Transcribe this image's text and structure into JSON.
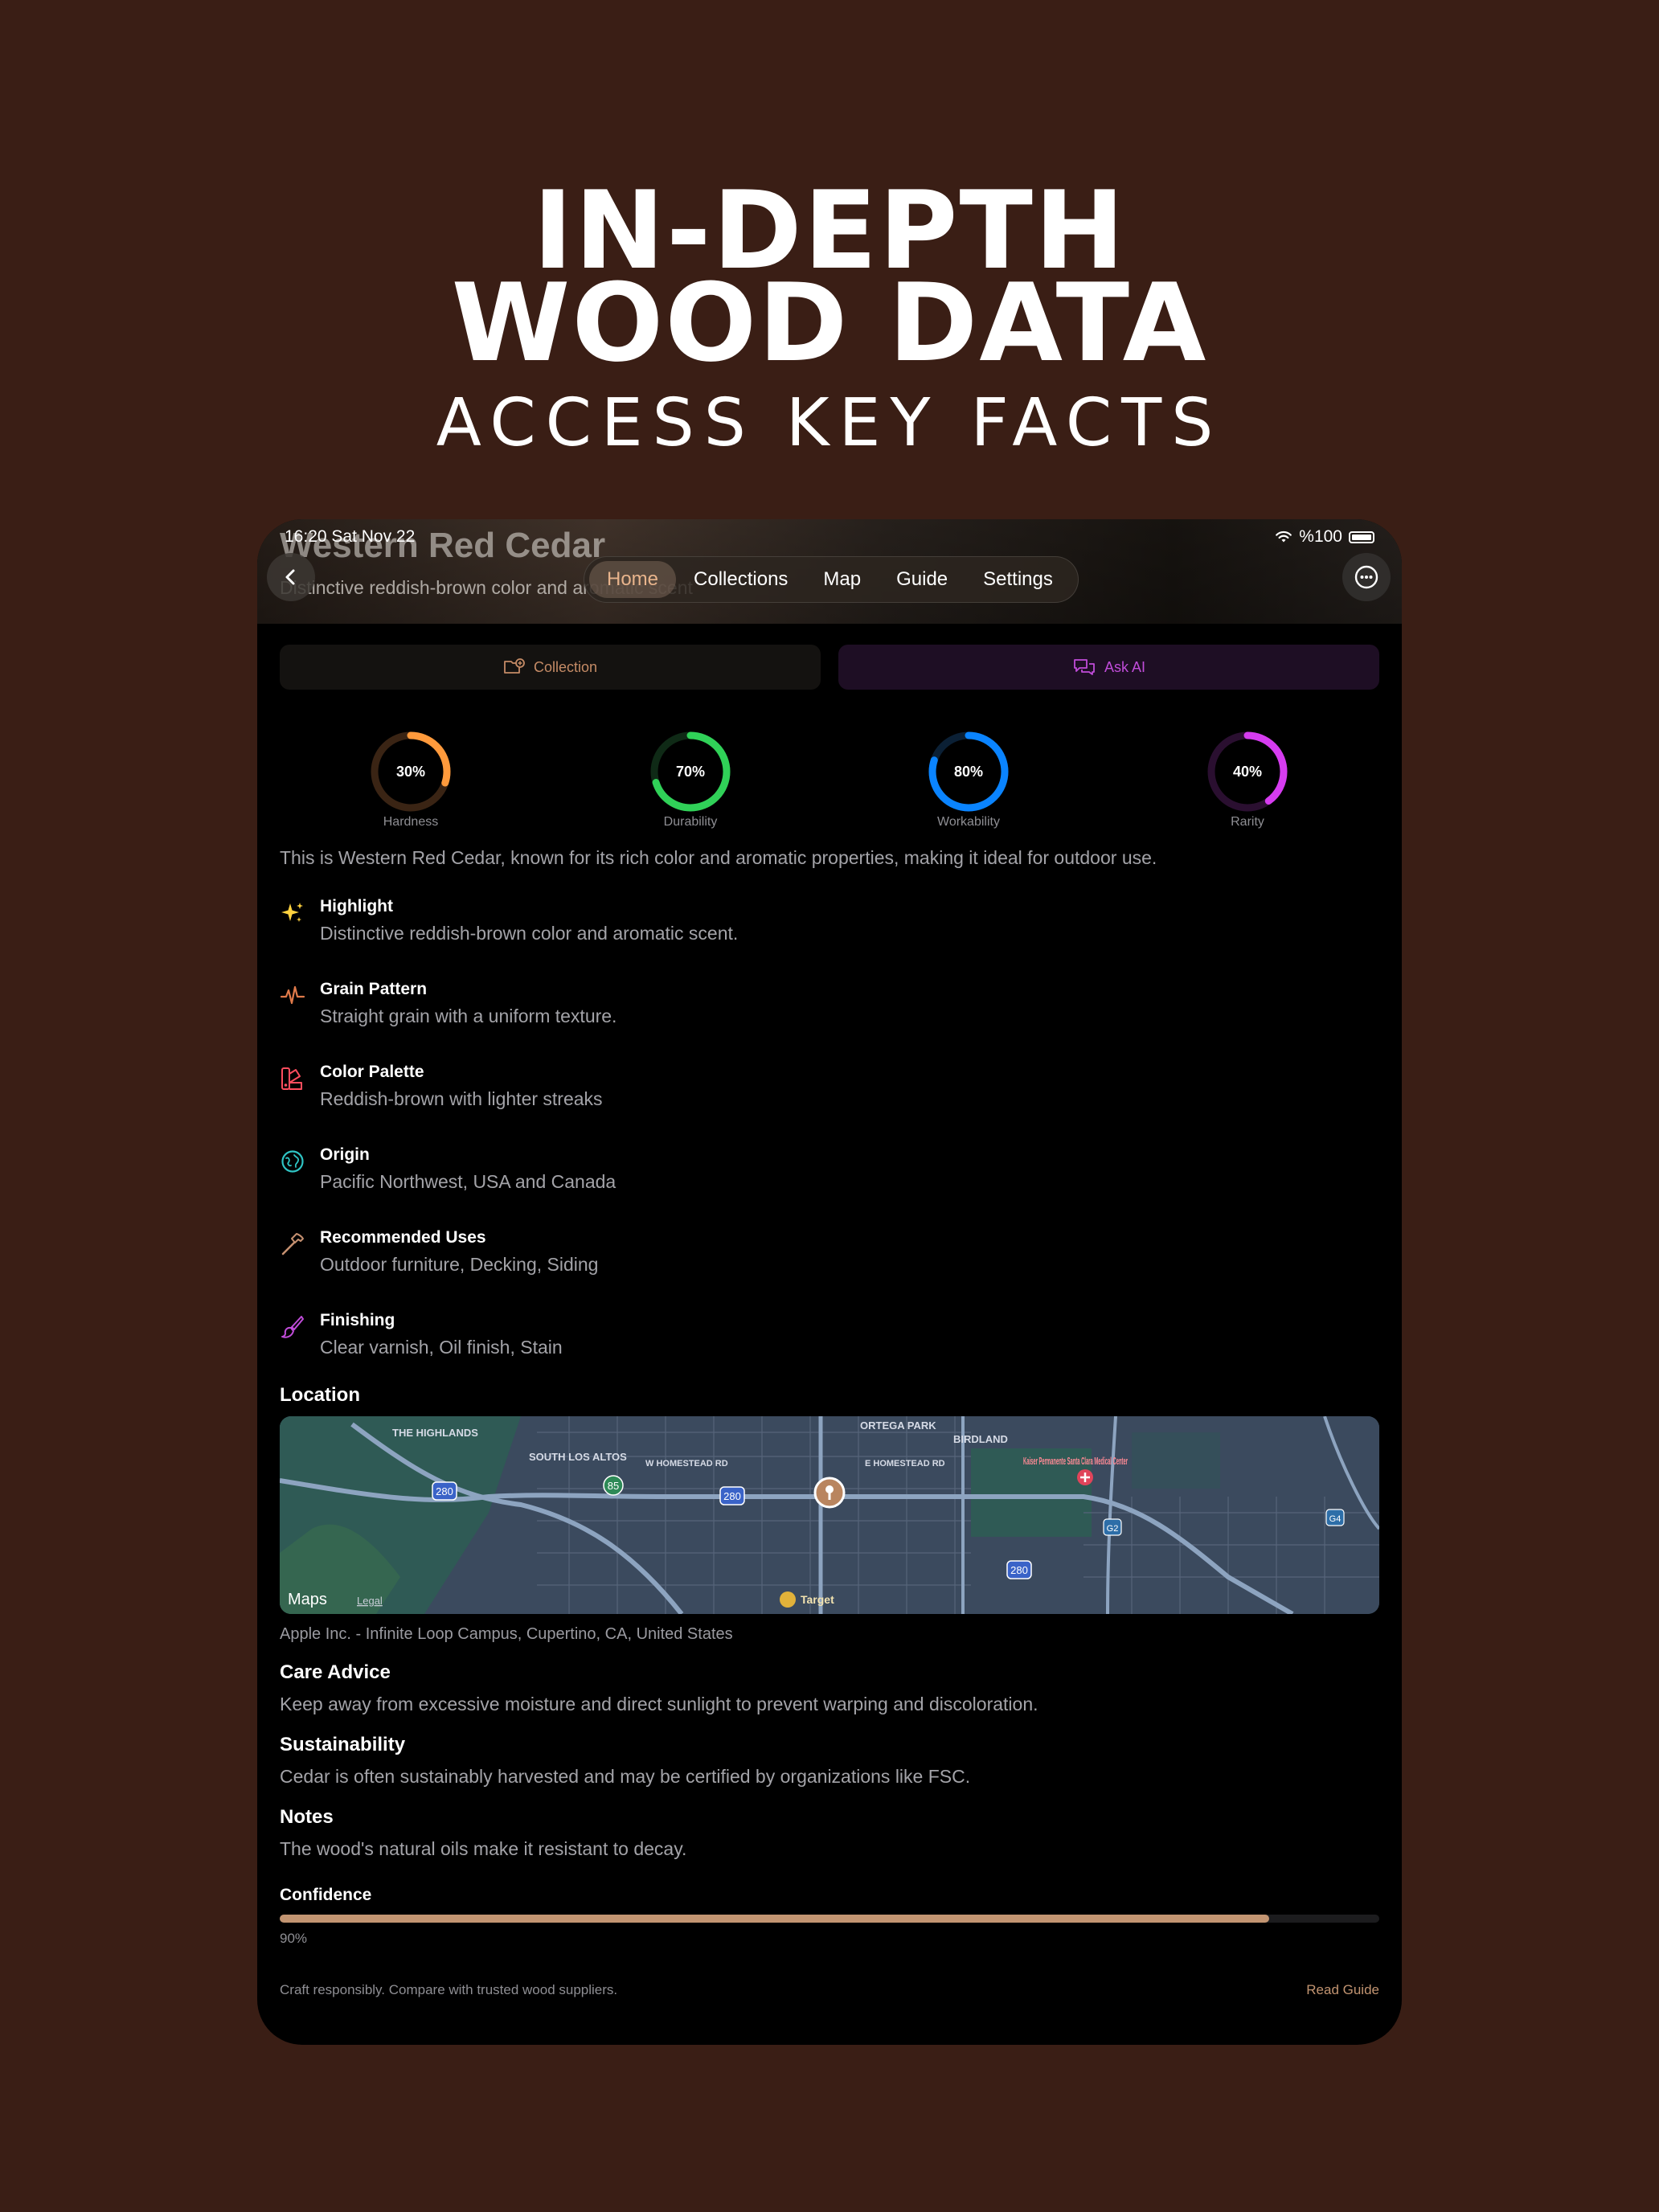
{
  "hero": {
    "line1": "IN-DEPTH",
    "line2": "WOOD DATA",
    "subtitle": "ACCESS KEY FACTS"
  },
  "status_bar": {
    "time": "16:20  Sat Nov 22",
    "battery": "%100"
  },
  "header": {
    "title": "Western Red Cedar",
    "subtitle": "Distinctive reddish-brown color and aromatic scent"
  },
  "tabs": [
    {
      "label": "Home",
      "active": true
    },
    {
      "label": "Collections",
      "active": false
    },
    {
      "label": "Map",
      "active": false
    },
    {
      "label": "Guide",
      "active": false
    },
    {
      "label": "Settings",
      "active": false
    }
  ],
  "actions": {
    "collection_label": "Collection",
    "ask_ai_label": "Ask AI"
  },
  "gauges": [
    {
      "label": "Hardness",
      "value": 30,
      "display": "30%",
      "color": "#ff9a3c",
      "track": "#3a2414"
    },
    {
      "label": "Durability",
      "value": 70,
      "display": "70%",
      "color": "#30d158",
      "track": "#0f2a16"
    },
    {
      "label": "Workability",
      "value": 80,
      "display": "80%",
      "color": "#0a84ff",
      "track": "#0b2035"
    },
    {
      "label": "Rarity",
      "value": 40,
      "display": "40%",
      "color": "#d63cf0",
      "track": "#2a0f30"
    }
  ],
  "summary": "This is Western Red Cedar, known for its rich color and aromatic properties, making it ideal for outdoor use.",
  "attributes": [
    {
      "title": "Highlight",
      "value": "Distinctive reddish-brown color and aromatic scent.",
      "icon": "sparkles-icon",
      "color": "#ffd23f"
    },
    {
      "title": "Grain Pattern",
      "value": "Straight grain with a uniform texture.",
      "icon": "waveform-icon",
      "color": "#e07a4a"
    },
    {
      "title": "Color Palette",
      "value": "Reddish-brown with lighter streaks",
      "icon": "swatch-icon",
      "color": "#ff4d5e"
    },
    {
      "title": "Origin",
      "value": "Pacific Northwest, USA and Canada",
      "icon": "globe-icon",
      "color": "#2fc4c4"
    },
    {
      "title": "Recommended Uses",
      "value": "Outdoor furniture, Decking, Siding",
      "icon": "hammer-icon",
      "color": "#c59070"
    },
    {
      "title": "Finishing",
      "value": "Clear varnish, Oil finish, Stain",
      "icon": "paintbrush-icon",
      "color": "#c04cd9"
    }
  ],
  "location": {
    "title": "Location",
    "caption": "Apple Inc. - Infinite Loop Campus, Cupertino, CA, United States",
    "map_brand": "Maps",
    "map_legal": "Legal",
    "map_labels": {
      "highlands": "THE HIGHLANDS",
      "south_los_altos": "SOUTH LOS ALTOS",
      "ortega_park": "ORTEGA PARK",
      "birdland": "BIRDLAND",
      "w_homestead": "W HOMESTEAD RD",
      "e_homestead": "E HOMESTEAD RD",
      "kaiser": "Kaiser Permanente Santa Clara Medical Center",
      "target": "Target",
      "hwy_280": "280",
      "hwy_85": "85",
      "hwy_g2": "G2",
      "hwy_g4": "G4"
    }
  },
  "care": {
    "title": "Care Advice",
    "body": "Keep away from excessive moisture and direct sunlight to prevent warping and discoloration."
  },
  "sustainability": {
    "title": "Sustainability",
    "body": "Cedar is often sustainably harvested and may be certified by organizations like FSC."
  },
  "notes": {
    "title": "Notes",
    "body": "The wood's natural oils make it resistant to decay."
  },
  "confidence": {
    "label": "Confidence",
    "value": 0.9,
    "display": "90%"
  },
  "footer": {
    "disclaimer": "Craft responsibly. Compare with trusted wood suppliers.",
    "link": "Read Guide"
  }
}
